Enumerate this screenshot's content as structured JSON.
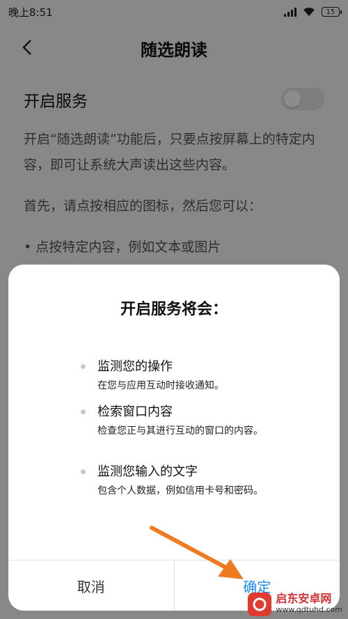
{
  "status_bar": {
    "time": "晚上8:51",
    "battery": "15"
  },
  "header": {
    "title": "随选朗读"
  },
  "setting": {
    "label": "开启服务",
    "enabled": false
  },
  "description": {
    "p1": "开启“随选朗读”功能后，只要点按屏幕上的特定内容，即可让系统大声读出这些内容。",
    "p2": "首先，请点按相应的图标，然后您可以：",
    "b1": "• 点按特定内容，例如文本或图片"
  },
  "dialog": {
    "title": "开启服务将会：",
    "items": [
      {
        "title": "监测您的操作",
        "desc": "在您与应用互动时接收通知。"
      },
      {
        "title": "检索窗口内容",
        "desc": "检查您正与其进行互动的窗口的内容。"
      },
      {
        "title": "监测您输入的文字",
        "desc": "包含个人数据，例如信用卡号和密码。"
      }
    ],
    "cancel_label": "取消",
    "ok_label": "确定"
  },
  "watermark": {
    "name": "启东安卓网",
    "url": "www.qdtuhd.com"
  },
  "colors": {
    "accent": "#1e8cf0",
    "arrow": "#f07a20"
  }
}
